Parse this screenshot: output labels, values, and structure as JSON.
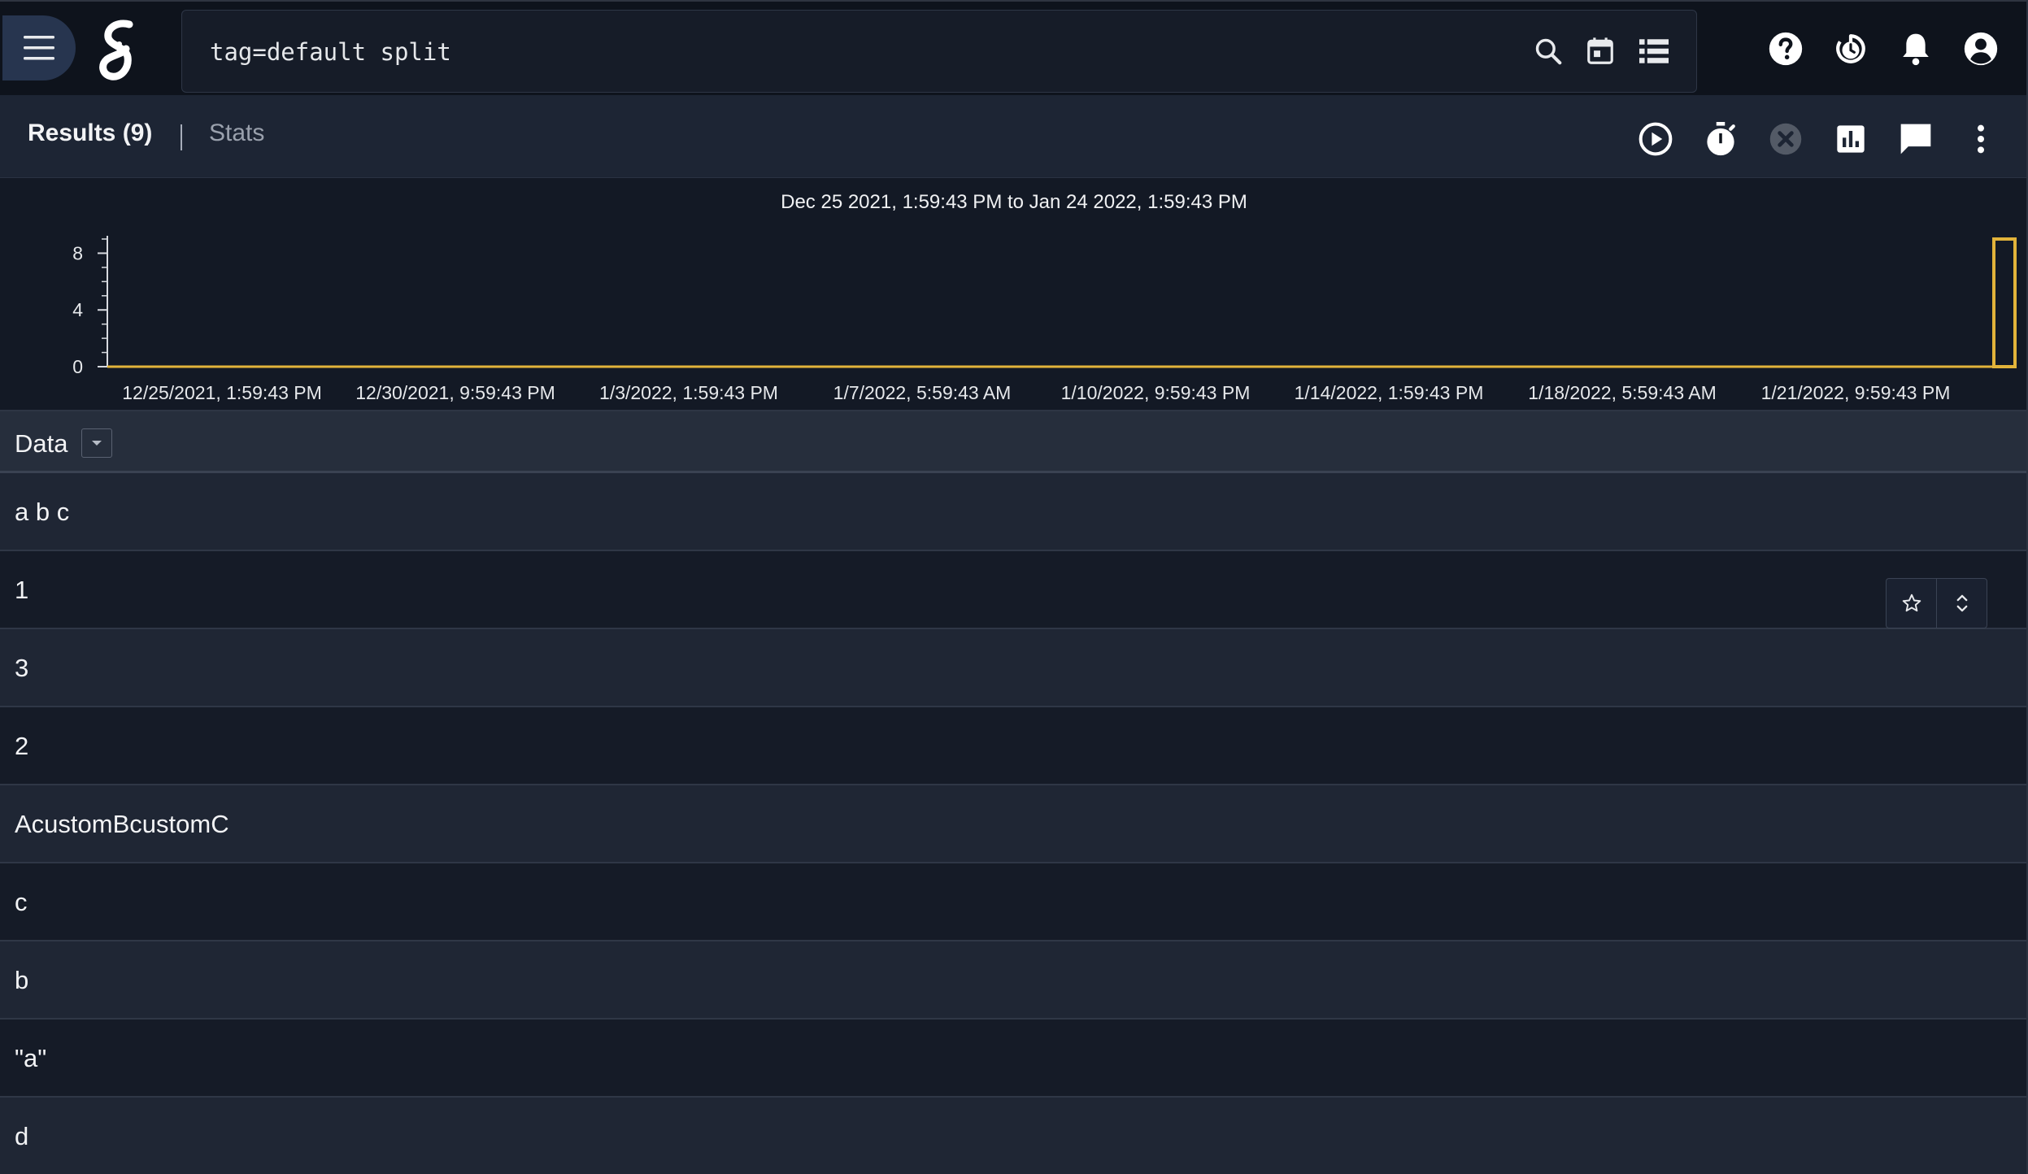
{
  "header": {
    "menu_icon": "hamburger-menu-icon",
    "logo_icon": "gravwell-logo-icon",
    "query": "tag=default split",
    "search_icons": [
      "search-icon",
      "calendar-icon",
      "list-view-icon"
    ],
    "top_icons": [
      "help-icon",
      "history-timer-icon",
      "notifications-bell-icon",
      "account-circle-icon"
    ]
  },
  "results_bar": {
    "results_tab": "Results (9)",
    "stats_tab": "Stats",
    "icons": [
      "play-circle-icon",
      "stopwatch-icon",
      "cancel-circle-icon",
      "bar-chart-icon",
      "comment-icon",
      "more-vert-icon"
    ]
  },
  "chart_data": {
    "type": "bar",
    "title": "Dec 25 2021, 1:59:43 PM to Jan 24 2022, 1:59:43 PM",
    "xlabel": "",
    "ylabel": "",
    "x_ticks": [
      "12/25/2021, 1:59:43 PM",
      "12/30/2021, 9:59:43 PM",
      "1/3/2022, 1:59:43 PM",
      "1/7/2022, 5:59:43 AM",
      "1/10/2022, 9:59:43 PM",
      "1/14/2022, 1:59:43 PM",
      "1/18/2022, 5:59:43 AM",
      "1/21/2022, 9:59:43 PM"
    ],
    "y_ticks": [
      0,
      4,
      8
    ],
    "ylim": [
      0,
      9
    ],
    "bins": 365,
    "values_by_bin": {
      "364": 9
    },
    "color": "#e2b33a",
    "grid": false
  },
  "table": {
    "column": "Data",
    "rows": [
      "a b c",
      "1",
      "3",
      "2",
      "AcustomBcustomC",
      "c",
      "b",
      "\"a\"",
      "d"
    ],
    "row_action_icons": [
      "star-outline-icon",
      "expand-unfold-icon"
    ]
  }
}
